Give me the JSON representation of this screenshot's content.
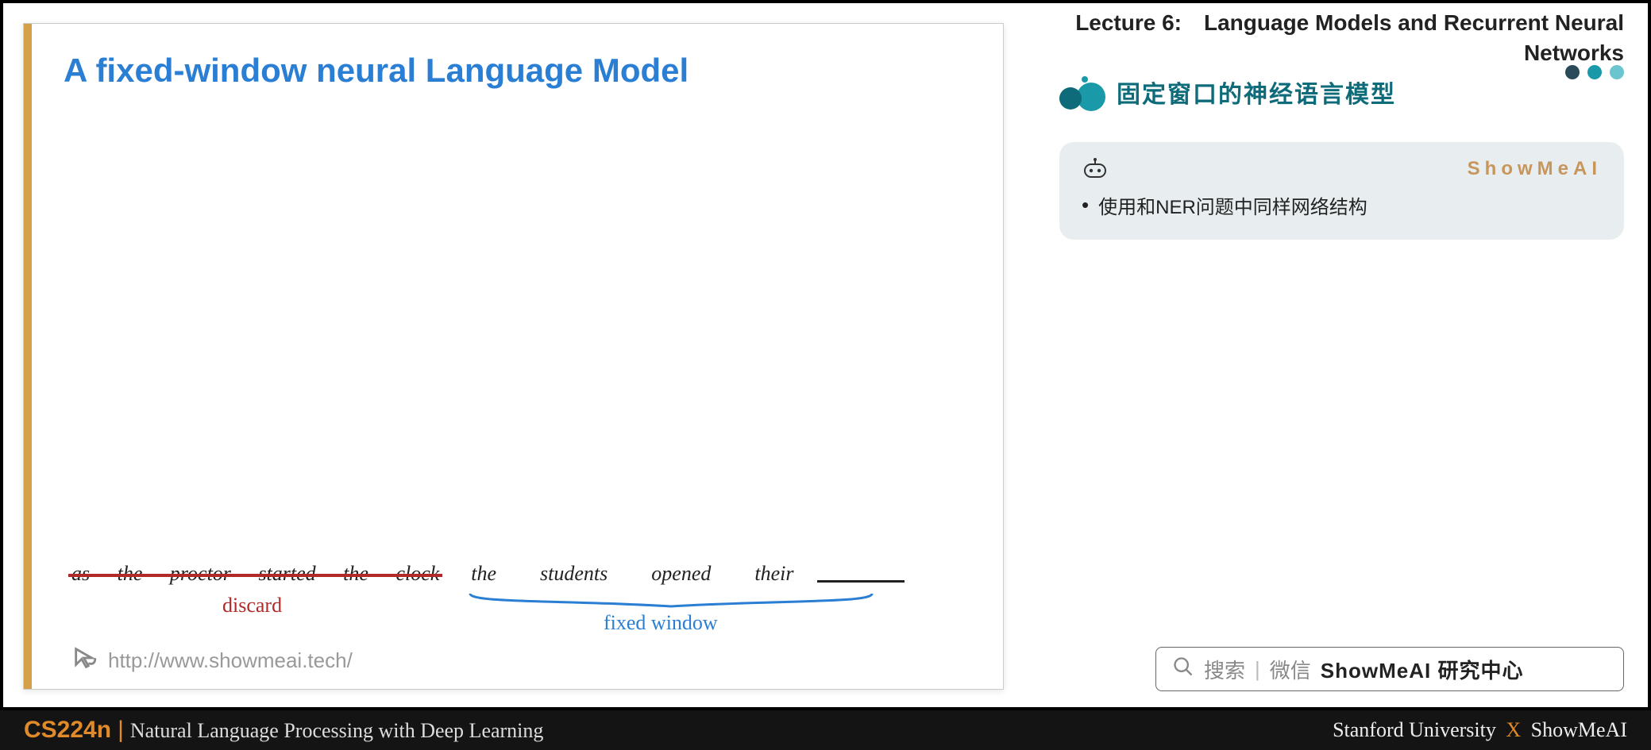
{
  "slide": {
    "title": "A fixed-window neural Language Model",
    "discard_words": [
      "as",
      "the",
      "proctor",
      "started",
      "the",
      "clock"
    ],
    "window_words": [
      "the",
      "students",
      "opened",
      "their"
    ],
    "discard_label": "discard",
    "fixed_window_label": "fixed window",
    "url": "http://www.showmeai.tech/"
  },
  "right": {
    "lecture_title_line1": "Lecture 6: Language Models and Recurrent Neural",
    "lecture_title_line2": "Networks",
    "section_title": "固定窗口的神经语言模型",
    "brand": "ShowMeAI",
    "bullet": "使用和NER问题中同样网络结构",
    "search_placeholder_1": "搜索",
    "search_placeholder_2": "微信",
    "search_label": "ShowMeAI 研究中心"
  },
  "footer": {
    "course_code": "CS224n",
    "course_name": "Natural Language Processing with Deep Learning",
    "right_org": "Stanford University",
    "right_brand": "ShowMeAI"
  }
}
